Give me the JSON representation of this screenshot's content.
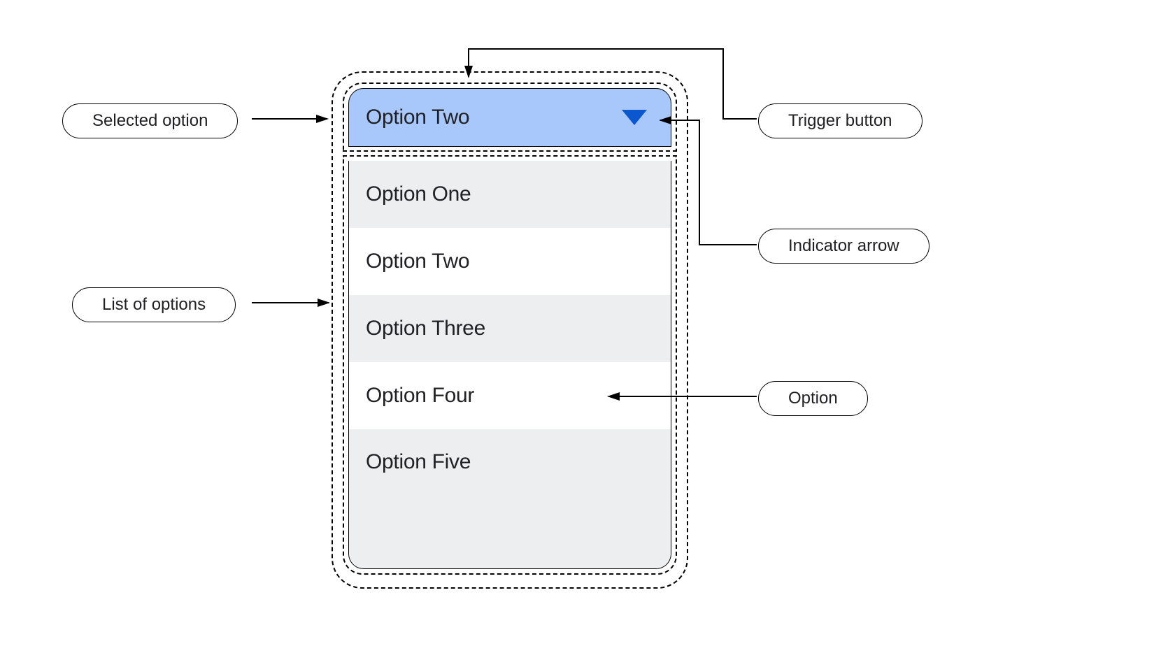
{
  "dropdown": {
    "selected_label": "Option Two",
    "options": [
      {
        "label": "Option One"
      },
      {
        "label": "Option Two"
      },
      {
        "label": "Option Three"
      },
      {
        "label": "Option  Four"
      },
      {
        "label": "Option Five"
      }
    ]
  },
  "callouts": {
    "selected_option": "Selected option",
    "list_of_options": "List of options",
    "trigger_button": "Trigger button",
    "indicator_arrow": "Indicator arrow",
    "option": "Option"
  }
}
